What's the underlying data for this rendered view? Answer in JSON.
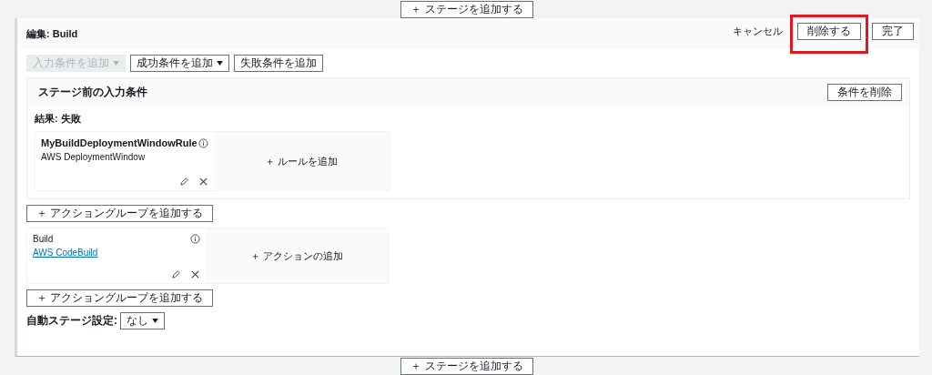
{
  "top_add_stage": {
    "label": "＋ ステージを追加する"
  },
  "editor": {
    "title": "編集: Build",
    "header_actions": [
      {
        "kind": "link",
        "label": "キャンセル",
        "highlighted": false
      },
      {
        "kind": "button",
        "label": "削除する",
        "highlighted": true
      },
      {
        "kind": "button",
        "label": "完了",
        "highlighted": false
      }
    ],
    "condition_buttons": [
      {
        "kind": "dropdown",
        "label": "入力条件を追加",
        "disabled": true
      },
      {
        "kind": "dropdown",
        "label": "成功条件を追加",
        "disabled": false
      },
      {
        "kind": "button",
        "label": "失敗条件を追加",
        "disabled": false
      }
    ],
    "condition_panel": {
      "title": "ステージ前の入力条件",
      "delete_button": "条件を削除",
      "result_label": "結果: 失敗",
      "rule": {
        "name": "MyBuildDeploymentWindowRule",
        "provider": "AWS DeploymentWindow"
      },
      "add_rule": "＋ ルールを追加"
    },
    "add_action_group_top": "＋ アクショングループを追加する",
    "action": {
      "name": "Build",
      "provider": "AWS CodeBuild"
    },
    "add_action": "＋ アクションの追加",
    "add_action_group_bottom": "＋ アクショングループを追加する",
    "auto_stage": {
      "label": "自動ステージ設定:",
      "value": "なし"
    }
  },
  "bottom_add_stage": {
    "label": "＋ ステージを追加する"
  }
}
